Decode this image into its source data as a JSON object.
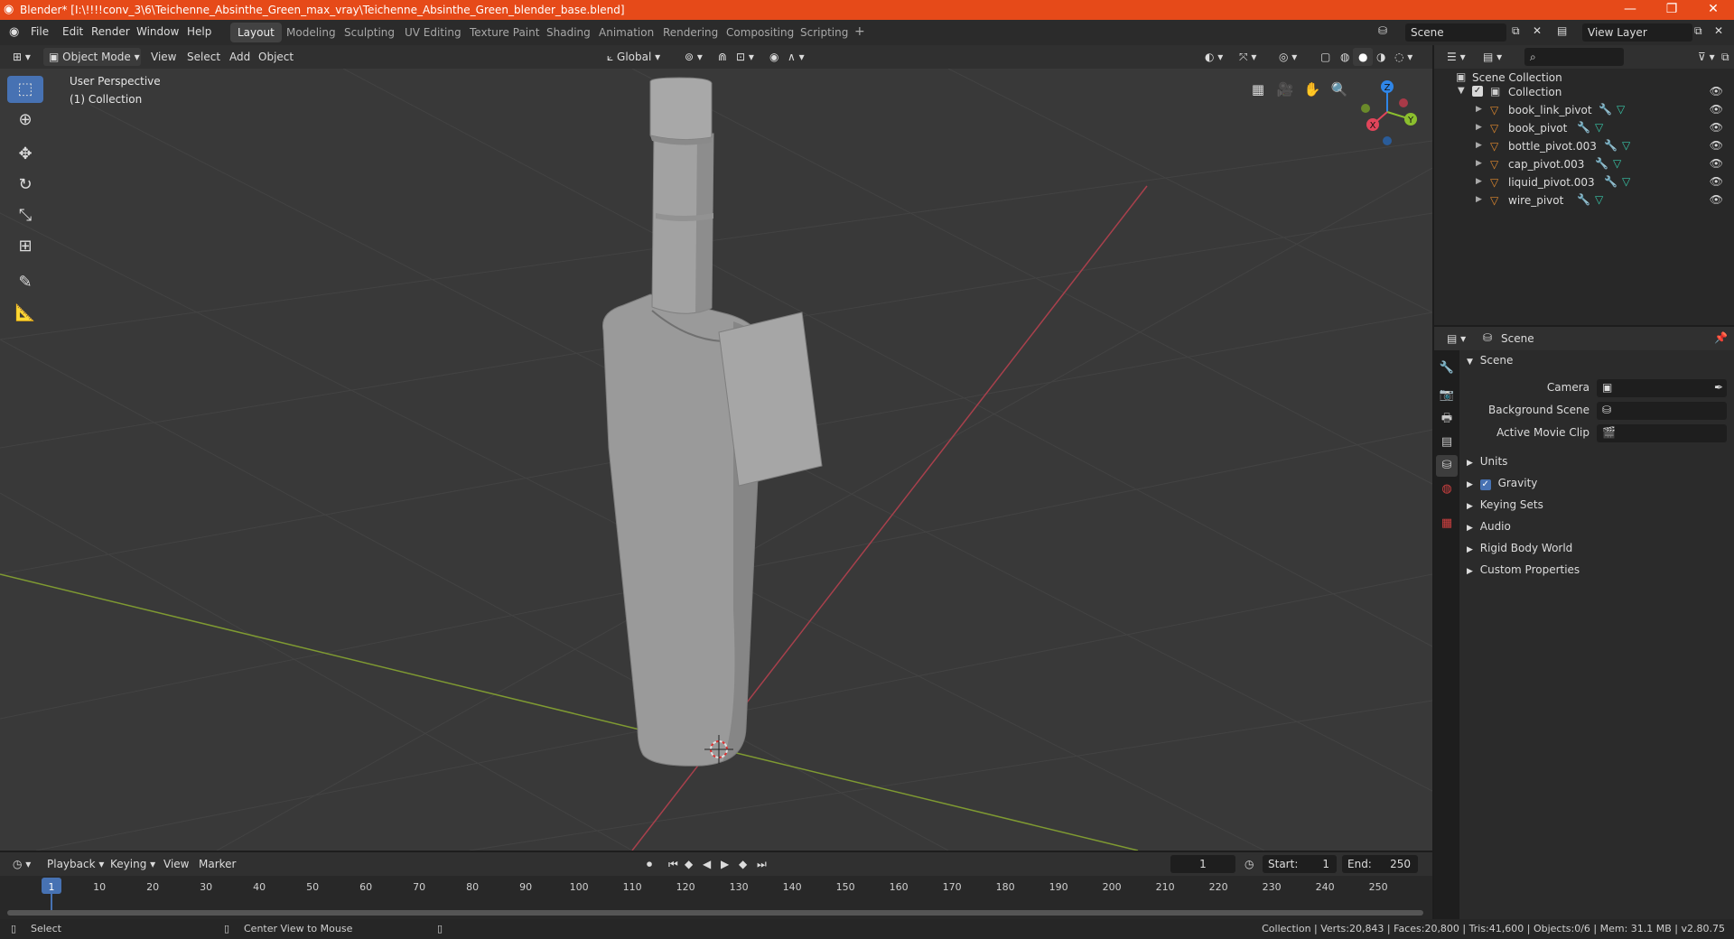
{
  "window": {
    "title": "Blender* [I:\\!!!!conv_3\\6\\Teichenne_Absinthe_Green_max_vray\\Teichenne_Absinthe_Green_blender_base.blend]",
    "minimize": "—",
    "maximize": "❐",
    "close": "✕"
  },
  "menu": {
    "items": [
      "File",
      "Edit",
      "Render",
      "Window",
      "Help"
    ]
  },
  "workspaces": {
    "tabs": [
      "Layout",
      "Modeling",
      "Sculpting",
      "UV Editing",
      "Texture Paint",
      "Shading",
      "Animation",
      "Rendering",
      "Compositing",
      "Scripting"
    ],
    "active": "Layout",
    "add": "+"
  },
  "scene_selector": {
    "value": "Scene"
  },
  "view_layer_selector": {
    "value": "View Layer"
  },
  "viewport_header": {
    "mode": "Object Mode",
    "view": "View",
    "select": "Select",
    "add": "Add",
    "object": "Object",
    "orientation": "Global"
  },
  "viewport": {
    "perspective": "User Perspective",
    "collection": "(1) Collection",
    "gizmo": {
      "x": "X",
      "y": "Y",
      "z": "Z"
    }
  },
  "outliner": {
    "root": "Scene Collection",
    "collection": "Collection",
    "objects": [
      "book_link_pivot",
      "book_pivot",
      "bottle_pivot.003",
      "cap_pivot.003",
      "liquid_pivot.003",
      "wire_pivot"
    ]
  },
  "properties": {
    "context": "Scene",
    "panel": "Scene",
    "camera_label": "Camera",
    "background_scene_label": "Background Scene",
    "active_movie_clip_label": "Active Movie Clip",
    "sections": [
      "Units",
      "Gravity",
      "Keying Sets",
      "Audio",
      "Rigid Body World",
      "Custom Properties"
    ]
  },
  "timeline": {
    "playback": "Playback",
    "keying": "Keying",
    "view": "View",
    "marker": "Marker",
    "current_frame": "1",
    "start_label": "Start:",
    "start": "1",
    "end_label": "End:",
    "end": "250",
    "ticks": [
      "1",
      "10",
      "20",
      "30",
      "40",
      "50",
      "60",
      "70",
      "80",
      "90",
      "100",
      "110",
      "120",
      "130",
      "140",
      "150",
      "160",
      "170",
      "180",
      "190",
      "200",
      "210",
      "220",
      "230",
      "240",
      "250"
    ]
  },
  "statusbar": {
    "select": "Select",
    "center_view": "Center View to Mouse",
    "stats": "Collection | Verts:20,843 | Faces:20,800 | Tris:41,600 | Objects:0/6 | Mem: 31.1 MB | v2.80.75"
  },
  "colors": {
    "titlebar": "#e64a19",
    "accent": "#4772b3",
    "x_axis": "#e0455a",
    "y_axis": "#8bbf2e",
    "z_axis": "#2f86e8"
  }
}
